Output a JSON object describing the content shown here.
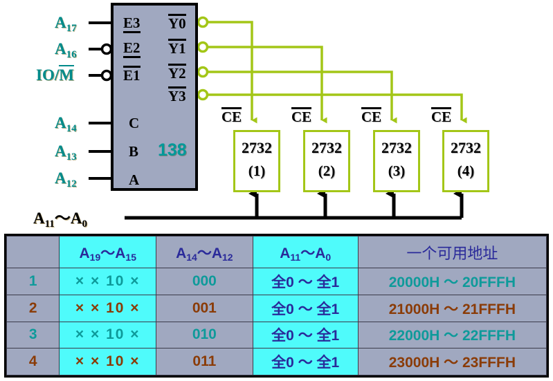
{
  "diagram": {
    "decoder": {
      "part_number": "138",
      "enable_pins": [
        {
          "label": "E3",
          "active_low": false,
          "name": "pin-e3"
        },
        {
          "label": "E2",
          "active_low": true,
          "name": "pin-e2"
        },
        {
          "label": "E1",
          "active_low": true,
          "name": "pin-e1"
        }
      ],
      "address_pins": [
        {
          "label": "C",
          "name": "pin-c"
        },
        {
          "label": "B",
          "name": "pin-b"
        },
        {
          "label": "A",
          "name": "pin-a"
        }
      ],
      "outputs": [
        {
          "label": "Y0",
          "name": "output-y0"
        },
        {
          "label": "Y1",
          "name": "output-y1"
        },
        {
          "label": "Y2",
          "name": "output-y2"
        },
        {
          "label": "Y3",
          "name": "output-y3"
        }
      ]
    },
    "input_signals": [
      {
        "base": "A",
        "sub": "17",
        "overline": false
      },
      {
        "base": "A",
        "sub": "16",
        "overline": false
      },
      {
        "base": "IO/M",
        "sub": "",
        "overline": true
      },
      {
        "base": "A",
        "sub": "14",
        "overline": false
      },
      {
        "base": "A",
        "sub": "13",
        "overline": false
      },
      {
        "base": "A",
        "sub": "12",
        "overline": false
      }
    ],
    "io_m_label": {
      "prefix": "IO/",
      "barred": "M"
    },
    "bus_label": {
      "high": "A",
      "high_sub": "11",
      "tilde": "～",
      "low": "A",
      "low_sub": "0"
    },
    "ce_label": "CE",
    "memories": [
      {
        "part": "2732",
        "index": "(1)"
      },
      {
        "part": "2732",
        "index": "(2)"
      },
      {
        "part": "2732",
        "index": "(3)"
      },
      {
        "part": "2732",
        "index": "(4)"
      }
    ],
    "colors": {
      "wire_green": "#a3c617",
      "chip_fill": "#a0a8c0",
      "signal_teal": "#008b8b",
      "part_number_teal": "#009999",
      "bus_black": "#000000"
    }
  },
  "table": {
    "headers": [
      {
        "text": "",
        "kind": "blank",
        "fill": "gray"
      },
      {
        "base": "A",
        "sub_hi": "19",
        "tilde": "～",
        "base2": "A",
        "sub_lo": "15",
        "kind": "range",
        "fill": "cyan"
      },
      {
        "base": "A",
        "sub_hi": "14",
        "tilde": "～",
        "base2": "A",
        "sub_lo": "12",
        "kind": "range",
        "fill": "gray"
      },
      {
        "base": "A",
        "sub_hi": "11",
        "tilde": "～",
        "base2": "A",
        "sub_lo": "0",
        "kind": "range",
        "fill": "cyan"
      },
      {
        "text": "一个可用地址",
        "kind": "cn",
        "fill": "gray"
      }
    ],
    "rows": [
      {
        "no": "1",
        "a19_a15": "× × 10 ×",
        "a14_a12": "000",
        "a11_a0": "全0 ～ 全1",
        "address": "20000H ～ 20FFFH",
        "color": "teal"
      },
      {
        "no": "2",
        "a19_a15": "× × 10 ×",
        "a14_a12": "001",
        "a11_a0": "全0 ～ 全1",
        "address": "21000H ～ 21FFFH",
        "color": "brown"
      },
      {
        "no": "3",
        "a19_a15": "× × 10 ×",
        "a14_a12": "010",
        "a11_a0": "全0 ～ 全1",
        "address": "22000H ～ 22FFFH",
        "color": "teal"
      },
      {
        "no": "4",
        "a19_a15": "× × 10 ×",
        "a14_a12": "011",
        "a11_a0": "全0 ～ 全1",
        "address": "23000H ～ 23FFFH",
        "color": "brown"
      }
    ],
    "colors": {
      "header_text": "#2a2a9a",
      "cyan_fill": "#4ffbfb",
      "gray_fill": "#a0a8c0",
      "teal": "#0e9a9a",
      "brown": "#8a3b06",
      "navy": "#2a2a9a"
    }
  }
}
